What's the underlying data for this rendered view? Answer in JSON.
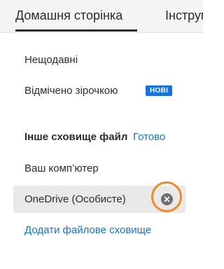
{
  "tabs": {
    "home": "Домашня сторінка",
    "tools": "Інструменти"
  },
  "nav": {
    "recent": "Нещодавні",
    "starred": "Відмічено зірочкою",
    "starred_badge": "НОВІ"
  },
  "storage": {
    "section_title": "Інше сховище файлів",
    "done_label": "Готово",
    "computer": "Ваш комп’ютер",
    "onedrive": "OneDrive (Особисте)",
    "add_storage": "Додати файлове сховище"
  },
  "icons": {
    "remove": "close-circle-icon"
  },
  "colors": {
    "accent": "#1473e6",
    "highlight": "#f08a24",
    "selected_row": "#e9e9e9",
    "tab_bar": "#f4f4f4"
  }
}
